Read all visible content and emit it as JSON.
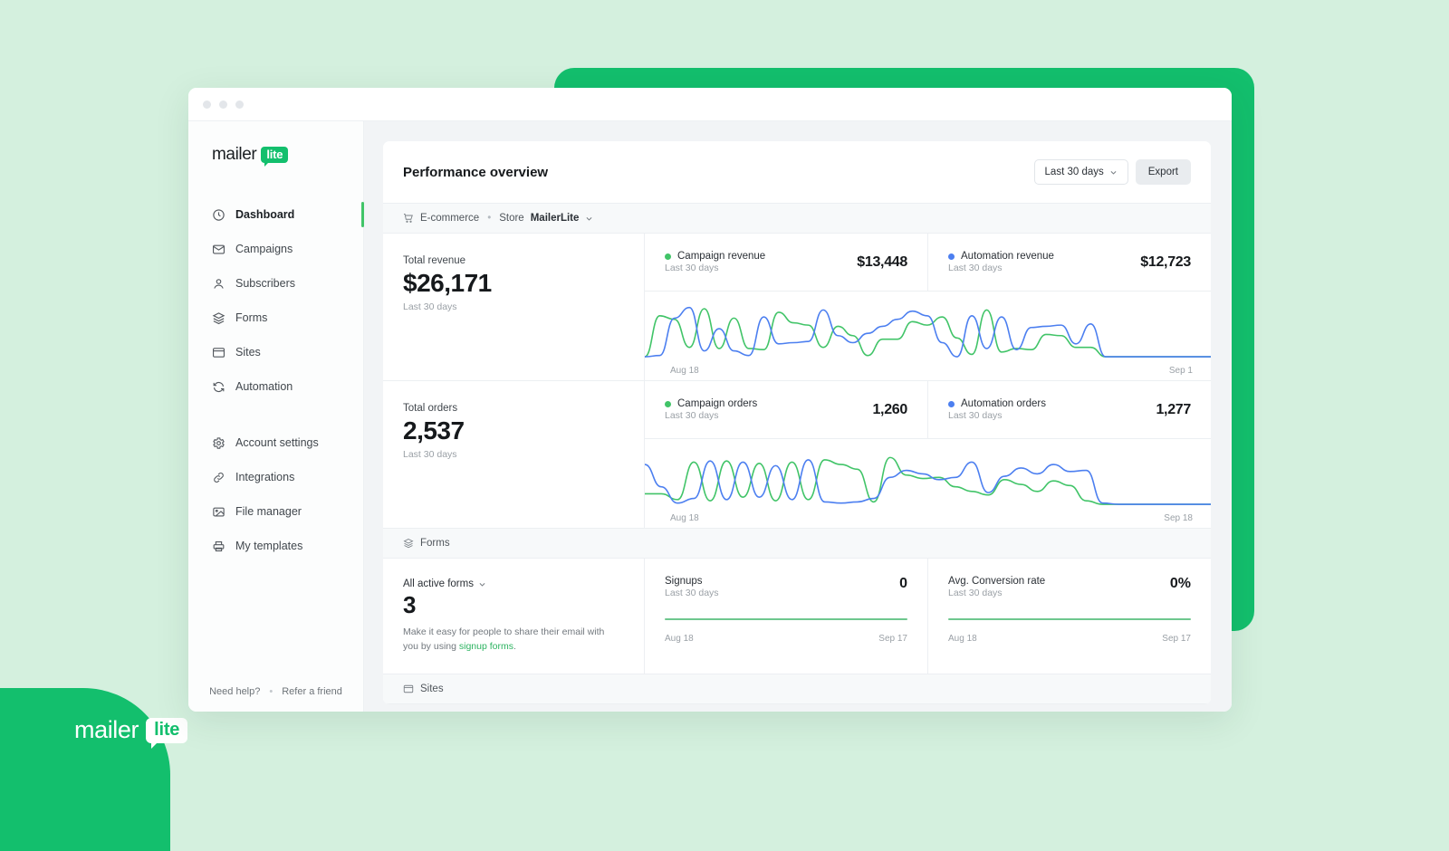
{
  "background": {
    "page_bg": "#d4f0de",
    "accent_green": "#13bf6d",
    "corner_logo": {
      "word": "mailer",
      "badge": "lite"
    }
  },
  "window": {
    "traffic_lights": 3
  },
  "sidebar": {
    "brand": {
      "word": "mailer",
      "badge": "lite"
    },
    "items": [
      {
        "label": "Dashboard",
        "icon": "clock-icon",
        "active": true
      },
      {
        "label": "Campaigns",
        "icon": "envelope-icon",
        "active": false
      },
      {
        "label": "Subscribers",
        "icon": "user-icon",
        "active": false
      },
      {
        "label": "Forms",
        "icon": "layers-icon",
        "active": false
      },
      {
        "label": "Sites",
        "icon": "browser-icon",
        "active": false
      },
      {
        "label": "Automation",
        "icon": "refresh-icon",
        "active": false
      }
    ],
    "items2": [
      {
        "label": "Account settings",
        "icon": "gear-icon"
      },
      {
        "label": "Integrations",
        "icon": "link-icon"
      },
      {
        "label": "File manager",
        "icon": "image-icon"
      },
      {
        "label": "My templates",
        "icon": "printer-icon"
      }
    ],
    "footer": {
      "help": "Need help?",
      "separator": "•",
      "refer": "Refer a friend"
    }
  },
  "header": {
    "title": "Performance overview",
    "date_range": "Last 30 days",
    "export_label": "Export"
  },
  "ecommerce_bar": {
    "label": "E-commerce",
    "separator": "•",
    "store_prefix": "Store",
    "store_name": "MailerLite"
  },
  "revenue": {
    "total_label": "Total revenue",
    "total_value": "$26,171",
    "total_sub": "Last 30 days",
    "campaign": {
      "label": "Campaign revenue",
      "sub": "Last 30 days",
      "value": "$13,448",
      "color": "#41c468"
    },
    "automation": {
      "label": "Automation revenue",
      "sub": "Last 30 days",
      "value": "$12,723",
      "color": "#4c7ff0"
    },
    "date_start": "Aug 18",
    "date_end": "Sep 1"
  },
  "orders": {
    "total_label": "Total orders",
    "total_value": "2,537",
    "total_sub": "Last 30 days",
    "campaign": {
      "label": "Campaign orders",
      "sub": "Last 30 days",
      "value": "1,260",
      "color": "#41c468"
    },
    "automation": {
      "label": "Automation orders",
      "sub": "Last 30 days",
      "value": "1,277",
      "color": "#4c7ff0"
    },
    "date_start": "Aug 18",
    "date_end": "Sep 18"
  },
  "forms_section": {
    "section_label": "Forms",
    "select_label": "All active forms",
    "count": "3",
    "description": "Make it easy for people to share their email with you by using ",
    "link_text": "signup forms",
    "description_end": ".",
    "signups": {
      "label": "Signups",
      "sub": "Last 30 days",
      "value": "0",
      "date_start": "Aug 18",
      "date_end": "Sep 17"
    },
    "conversion": {
      "label": "Avg. Conversion rate",
      "sub": "Last 30 days",
      "value": "0%",
      "date_start": "Aug 18",
      "date_end": "Sep 17"
    }
  },
  "sites_section": {
    "section_label": "Sites"
  },
  "chart_data": [
    {
      "type": "line",
      "title": "Revenue sparkline",
      "xlabel": "",
      "ylabel": "",
      "x_ticks": [
        "Aug 18",
        "Sep 1"
      ],
      "grid": false,
      "legend": [
        "Campaign revenue",
        "Automation revenue"
      ],
      "series": [
        {
          "name": "Campaign revenue",
          "color": "#41c468",
          "values": [
            4,
            74,
            68,
            20,
            86,
            18,
            70,
            18,
            16,
            80,
            62,
            58,
            20,
            56,
            40,
            6,
            34,
            34,
            64,
            58,
            72,
            36,
            8,
            84,
            12,
            18,
            16,
            42,
            40,
            20,
            20,
            4,
            4,
            4
          ]
        },
        {
          "name": "Automation revenue",
          "color": "#4c7ff0",
          "values": [
            4,
            6,
            70,
            88,
            14,
            52,
            14,
            6,
            72,
            26,
            28,
            30,
            84,
            40,
            28,
            44,
            56,
            68,
            82,
            74,
            28,
            4,
            74,
            18,
            72,
            16,
            54,
            56,
            58,
            26,
            60,
            4,
            4,
            4
          ]
        }
      ]
    },
    {
      "type": "line",
      "title": "Orders sparkline",
      "xlabel": "",
      "ylabel": "",
      "x_ticks": [
        "Aug 18",
        "Sep 18"
      ],
      "grid": false,
      "legend": [
        "Campaign orders",
        "Automation orders"
      ],
      "series": [
        {
          "name": "Campaign orders",
          "color": "#41c468",
          "values": [
            22,
            22,
            12,
            76,
            10,
            78,
            16,
            74,
            10,
            76,
            12,
            80,
            72,
            64,
            8,
            84,
            54,
            48,
            50,
            34,
            26,
            20,
            46,
            38,
            26,
            44,
            36,
            10,
            4,
            4,
            4
          ]
        },
        {
          "name": "Automation orders",
          "color": "#4c7ff0",
          "values": [
            72,
            34,
            6,
            14,
            78,
            12,
            76,
            16,
            70,
            12,
            80,
            8,
            6,
            8,
            14,
            50,
            62,
            56,
            46,
            50,
            76,
            24,
            52,
            66,
            56,
            72,
            60,
            62,
            6,
            4,
            4
          ]
        }
      ]
    }
  ]
}
